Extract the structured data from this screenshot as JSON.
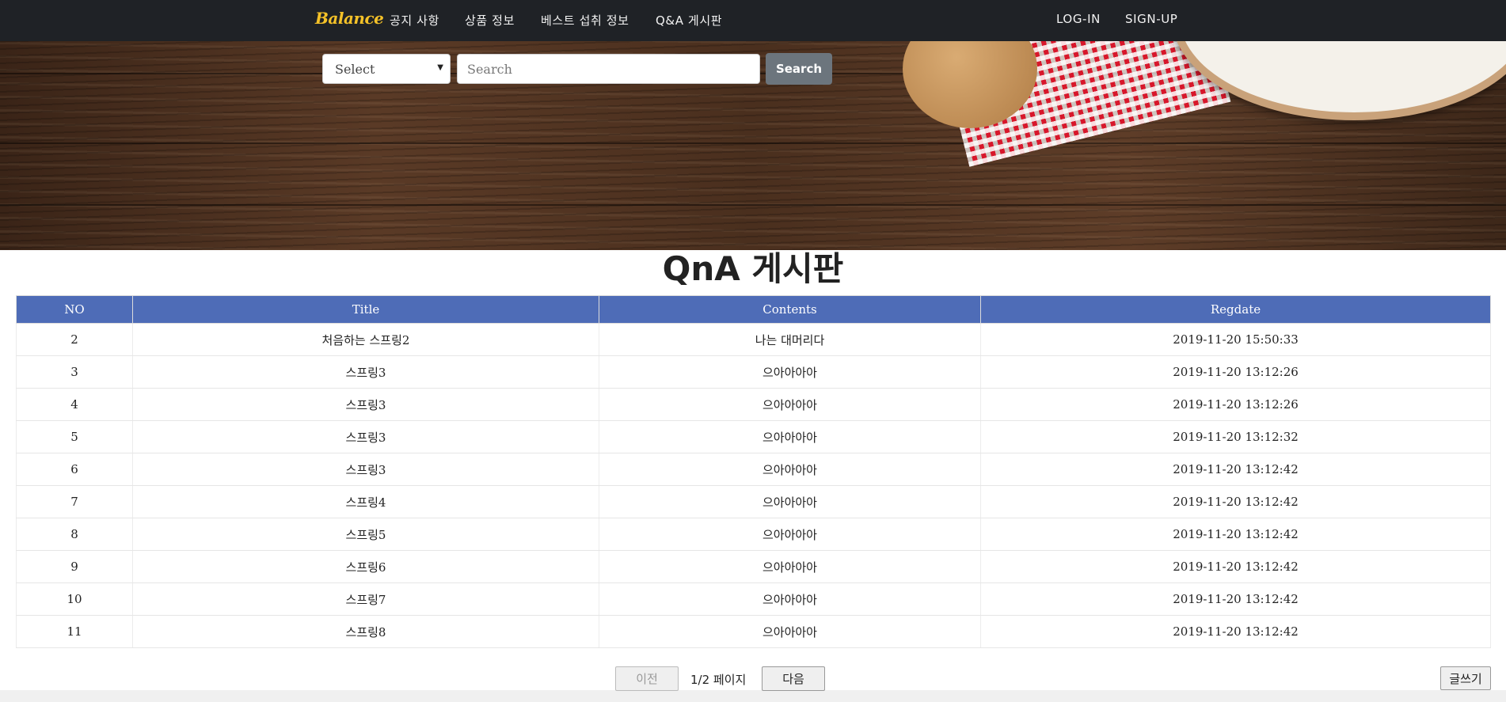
{
  "navbar": {
    "brand": "Balance",
    "links": [
      "공지 사항",
      "상품 정보",
      "베스트 섭취 정보",
      "Q&A 게시판"
    ],
    "login": "LOG-IN",
    "signup": "SIGN-UP"
  },
  "search": {
    "select_value": "Select",
    "placeholder": "Search",
    "button_label": "Search"
  },
  "board": {
    "title": "QnA 게시판",
    "columns": [
      "NO",
      "Title",
      "Contents",
      "Regdate"
    ],
    "rows": [
      {
        "no": "2",
        "title": "처음하는 스프링2",
        "contents": "나는 대머리다",
        "regdate": "2019-11-20 15:50:33"
      },
      {
        "no": "3",
        "title": "스프링3",
        "contents": "으아아아아",
        "regdate": "2019-11-20 13:12:26"
      },
      {
        "no": "4",
        "title": "스프링3",
        "contents": "으아아아아",
        "regdate": "2019-11-20 13:12:26"
      },
      {
        "no": "5",
        "title": "스프링3",
        "contents": "으아아아아",
        "regdate": "2019-11-20 13:12:32"
      },
      {
        "no": "6",
        "title": "스프링3",
        "contents": "으아아아아",
        "regdate": "2019-11-20 13:12:42"
      },
      {
        "no": "7",
        "title": "스프링4",
        "contents": "으아아아아",
        "regdate": "2019-11-20 13:12:42"
      },
      {
        "no": "8",
        "title": "스프링5",
        "contents": "으아아아아",
        "regdate": "2019-11-20 13:12:42"
      },
      {
        "no": "9",
        "title": "스프링6",
        "contents": "으아아아아",
        "regdate": "2019-11-20 13:12:42"
      },
      {
        "no": "10",
        "title": "스프링7",
        "contents": "으아아아아",
        "regdate": "2019-11-20 13:12:42"
      },
      {
        "no": "11",
        "title": "스프링8",
        "contents": "으아아아아",
        "regdate": "2019-11-20 13:12:42"
      }
    ]
  },
  "pagination": {
    "prev_label": "이전",
    "page_info": "1/2 페이지",
    "next_label": "다음"
  },
  "write_button": "글쓰기",
  "colors": {
    "navbar_bg": "#1f2226",
    "brand": "#f5c228",
    "table_header": "#4e6cb7",
    "search_button": "#6c757d"
  }
}
